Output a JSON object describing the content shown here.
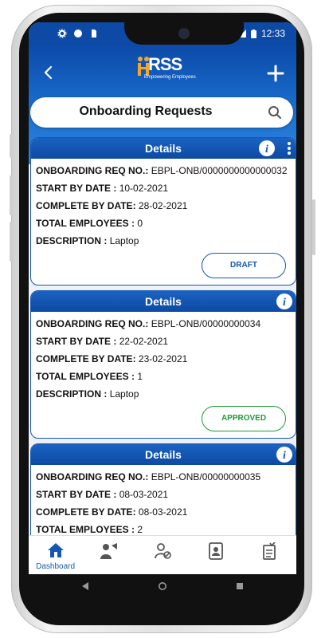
{
  "statusbar": {
    "time": "12:33"
  },
  "header": {
    "logo_text": "RSS",
    "logo_tagline": "Empowering Employees"
  },
  "search": {
    "title": "Onboarding Requests"
  },
  "cards": [
    {
      "title": "Details",
      "req_label": "ONBOARDING REQ NO.:",
      "req_value": "EBPL-ONB/0000000000000032",
      "start_label": "START BY DATE :",
      "start_value": "10-02-2021",
      "complete_label": "COMPLETE BY DATE:",
      "complete_value": "28-02-2021",
      "total_label": "TOTAL EMPLOYEES :",
      "total_value": "0",
      "desc_label": "DESCRIPTION :",
      "desc_value": "Laptop",
      "status": "DRAFT",
      "status_color": "#1557b5"
    },
    {
      "title": "Details",
      "req_label": "ONBOARDING REQ NO.:",
      "req_value": "EBPL-ONB/00000000034",
      "start_label": "START BY DATE :",
      "start_value": "22-02-2021",
      "complete_label": "COMPLETE BY DATE:",
      "complete_value": "23-02-2021",
      "total_label": "TOTAL EMPLOYEES :",
      "total_value": "1",
      "desc_label": "DESCRIPTION :",
      "desc_value": "Laptop",
      "status": "APPROVED",
      "status_color": "#1f9a3a"
    },
    {
      "title": "Details",
      "req_label": "ONBOARDING REQ NO.:",
      "req_value": "EBPL-ONB/00000000035",
      "start_label": "START BY DATE :",
      "start_value": "08-03-2021",
      "complete_label": "COMPLETE BY DATE:",
      "complete_value": "08-03-2021",
      "total_label": "TOTAL EMPLOYEES :",
      "total_value": "2"
    }
  ],
  "bottom_nav": {
    "dashboard_label": "Dashboard"
  },
  "colors": {
    "primary": "#1557b5",
    "approved": "#1f9a3a"
  },
  "icons": [
    "settings-icon",
    "circle-icon",
    "sim-icon",
    "wifi-icon",
    "signal-icon",
    "battery-icon",
    "back-arrow-icon",
    "plus-icon",
    "search-icon",
    "info-icon",
    "more-vert-icon",
    "home-icon",
    "employee-icon",
    "user-block-icon",
    "contact-book-icon",
    "document-check-icon"
  ]
}
